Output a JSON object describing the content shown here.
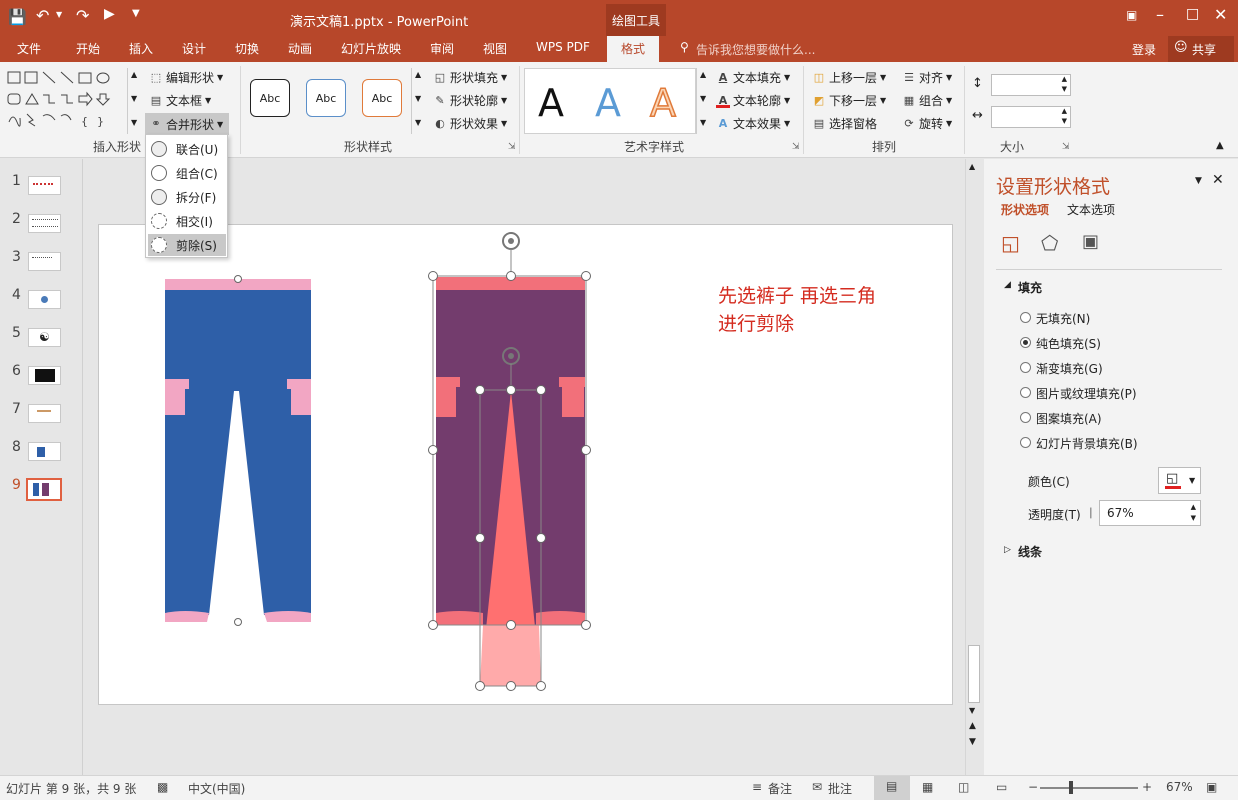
{
  "titlebar": {
    "doc_title": "演示文稿1.pptx - PowerPoint",
    "context_tab": "绘图工具"
  },
  "tabs": [
    "文件",
    "开始",
    "插入",
    "设计",
    "切换",
    "动画",
    "幻灯片放映",
    "审阅",
    "视图",
    "WPS PDF",
    "格式"
  ],
  "tellme": "告诉我您想要做什么...",
  "account": {
    "login": "登录",
    "share": "共享"
  },
  "ribbon": {
    "insert_shapes": {
      "edit_shape": "编辑形状",
      "textbox": "文本框",
      "merge_shapes": "合并形状",
      "label": "插入形状"
    },
    "shape_styles": {
      "style_text": "Abc",
      "fill": "形状填充",
      "outline": "形状轮廓",
      "effect": "形状效果",
      "label": "形状样式"
    },
    "wordart": {
      "letter": "A",
      "text_fill": "文本填充",
      "text_outline": "文本轮廓",
      "text_effect": "文本效果",
      "label": "艺术字样式"
    },
    "arrange": {
      "bring_forward": "上移一层",
      "send_backward": "下移一层",
      "selection_pane": "选择窗格",
      "align": "对齐",
      "group": "组合",
      "rotate": "旋转",
      "label": "排列"
    },
    "size": {
      "label": "大小"
    }
  },
  "merge_menu": [
    "联合(U)",
    "组合(C)",
    "拆分(F)",
    "相交(I)",
    "剪除(S)"
  ],
  "slides": [
    "1",
    "2",
    "3",
    "4",
    "5",
    "6",
    "7",
    "8",
    "9"
  ],
  "slide_note": "先选裤子 再选三角\n进行剪除",
  "panel": {
    "title": "设置形状格式",
    "tab_shape": "形状选项",
    "tab_text": "文本选项",
    "fill_section": "填充",
    "fill_options": [
      "无填充(N)",
      "纯色填充(S)",
      "渐变填充(G)",
      "图片或纹理填充(P)",
      "图案填充(A)",
      "幻灯片背景填充(B)"
    ],
    "selected_fill": 1,
    "color_label": "颜色(C)",
    "transparency_label": "透明度(T)",
    "transparency_value": "67%",
    "line_section": "线条"
  },
  "status": {
    "slide_info": "幻灯片 第 9 张，共 9 张",
    "language": "中文(中国)",
    "notes": "备注",
    "comments": "批注",
    "zoom": "67%"
  },
  "colors": {
    "brand": "#b7472a",
    "pants_blue": "#2e5fa8",
    "pants_pink": "#f2a6c3",
    "overlay_purple": "#733c6d",
    "triangle": "#ff7070",
    "annotation": "#d42b1f"
  }
}
